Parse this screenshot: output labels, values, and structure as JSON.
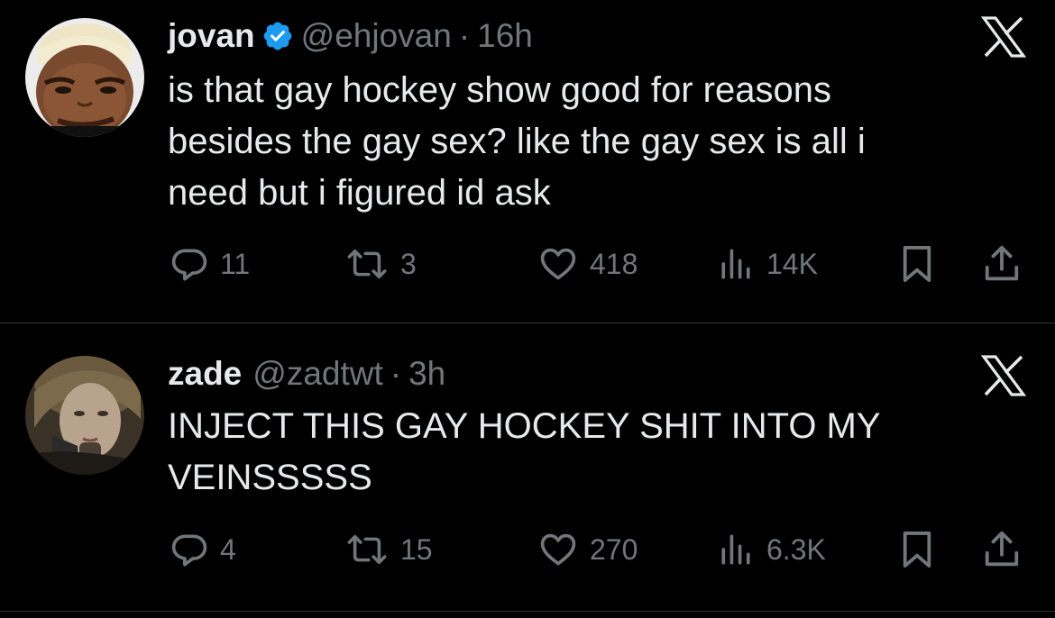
{
  "tweets": [
    {
      "name": "jovan",
      "verified": true,
      "handle": "@ehjovan",
      "separator": "·",
      "time": "16h",
      "text_lines": [
        "is that gay hockey show good for reasons",
        "besides the gay sex? like the gay sex is all i",
        "need but i figured id ask"
      ],
      "replies": "11",
      "reposts": "3",
      "likes": "418",
      "views": "14K"
    },
    {
      "name": "zade",
      "verified": false,
      "handle": "@zadtwt",
      "separator": "·",
      "time": "3h",
      "text_lines": [
        "INJECT THIS GAY HOCKEY SHIT INTO MY",
        "VEINSSSSS"
      ],
      "replies": "4",
      "reposts": "15",
      "likes": "270",
      "views": "6.3K"
    }
  ],
  "icons": {
    "verified": "verified-badge-icon",
    "logo": "x-logo-icon",
    "reply": "reply-icon",
    "repost": "repost-icon",
    "like": "heart-icon",
    "views": "views-chart-icon",
    "bookmark": "bookmark-icon",
    "share": "share-icon"
  },
  "colors": {
    "background": "#000000",
    "text": "#e7e9ea",
    "secondary": "#71767b",
    "verified": "#1d9bf0",
    "divider": "#2f3336"
  }
}
